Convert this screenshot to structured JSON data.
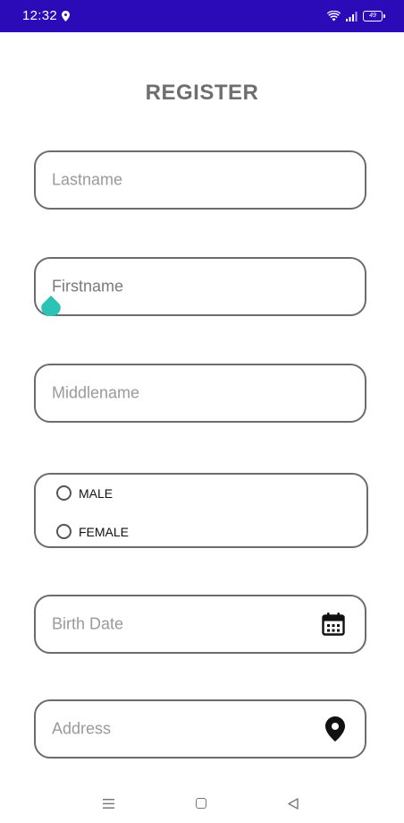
{
  "status_bar": {
    "time": "12:32",
    "battery": "49",
    "background": "#2a0bb7"
  },
  "title": "REGISTER",
  "fields": {
    "lastname_placeholder": "Lastname",
    "firstname_placeholder": "Firstname",
    "middlename_placeholder": "Middlename",
    "birthdate_placeholder": "Birth Date",
    "address_placeholder": "Address"
  },
  "gender": {
    "options": [
      "MALE",
      "FEMALE"
    ],
    "selected": null
  },
  "icons": {
    "birthdate": "calendar-icon",
    "address": "location-pin-icon",
    "cursor_handle_color": "#2cc3b6"
  },
  "nav": {
    "items": [
      "menu-icon",
      "home-icon",
      "back-icon"
    ]
  }
}
